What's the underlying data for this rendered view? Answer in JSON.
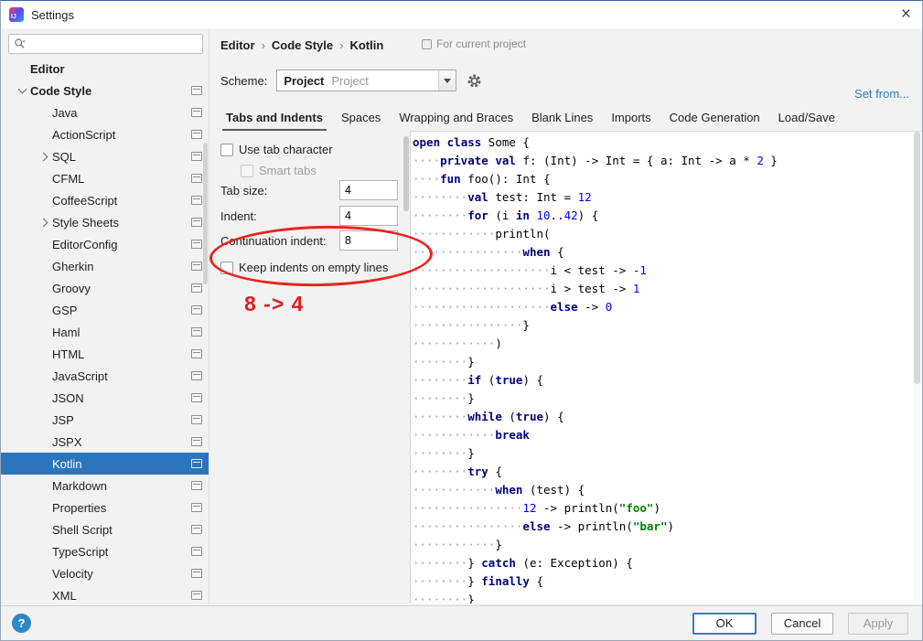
{
  "window": {
    "title": "Settings",
    "close_glyph": "×",
    "logo_text": "IJ"
  },
  "colors": {
    "selection_blue": "#2b75bd",
    "link_blue": "#2e7bc4",
    "annotation_red": "#e02020",
    "syntax_keyword": "#000080",
    "syntax_number": "#0000ff",
    "syntax_string": "#008000"
  },
  "sidebar": {
    "search": {
      "value": ""
    },
    "tree": [
      {
        "label": "Editor",
        "level": 0,
        "bold": true,
        "arrow": "none",
        "icon": false
      },
      {
        "label": "Code Style",
        "level": 0,
        "bold": true,
        "arrow": "down",
        "icon": true
      },
      {
        "label": "Java",
        "level": 1,
        "arrow": "none",
        "icon": true
      },
      {
        "label": "ActionScript",
        "level": 1,
        "arrow": "none",
        "icon": true
      },
      {
        "label": "SQL",
        "level": 1,
        "arrow": "right",
        "icon": true
      },
      {
        "label": "CFML",
        "level": 1,
        "arrow": "none",
        "icon": true
      },
      {
        "label": "CoffeeScript",
        "level": 1,
        "arrow": "none",
        "icon": true
      },
      {
        "label": "Style Sheets",
        "level": 1,
        "arrow": "right",
        "icon": true
      },
      {
        "label": "EditorConfig",
        "level": 1,
        "arrow": "none",
        "icon": true
      },
      {
        "label": "Gherkin",
        "level": 1,
        "arrow": "none",
        "icon": true
      },
      {
        "label": "Groovy",
        "level": 1,
        "arrow": "none",
        "icon": true
      },
      {
        "label": "GSP",
        "level": 1,
        "arrow": "none",
        "icon": true
      },
      {
        "label": "Haml",
        "level": 1,
        "arrow": "none",
        "icon": true
      },
      {
        "label": "HTML",
        "level": 1,
        "arrow": "none",
        "icon": true
      },
      {
        "label": "JavaScript",
        "level": 1,
        "arrow": "none",
        "icon": true
      },
      {
        "label": "JSON",
        "level": 1,
        "arrow": "none",
        "icon": true
      },
      {
        "label": "JSP",
        "level": 1,
        "arrow": "none",
        "icon": true
      },
      {
        "label": "JSPX",
        "level": 1,
        "arrow": "none",
        "icon": true
      },
      {
        "label": "Kotlin",
        "level": 1,
        "arrow": "none",
        "icon": true,
        "selected": true
      },
      {
        "label": "Markdown",
        "level": 1,
        "arrow": "none",
        "icon": true
      },
      {
        "label": "Properties",
        "level": 1,
        "arrow": "none",
        "icon": true
      },
      {
        "label": "Shell Script",
        "level": 1,
        "arrow": "none",
        "icon": true
      },
      {
        "label": "TypeScript",
        "level": 1,
        "arrow": "none",
        "icon": true
      },
      {
        "label": "Velocity",
        "level": 1,
        "arrow": "none",
        "icon": true
      },
      {
        "label": "XML",
        "level": 1,
        "arrow": "none",
        "icon": true
      }
    ]
  },
  "header": {
    "breadcrumb": [
      "Editor",
      "Code Style",
      "Kotlin"
    ],
    "separator": "›",
    "scope_note": "For current project",
    "scheme_label": "Scheme:",
    "scheme_value": "Project",
    "scheme_value_secondary": "Project",
    "set_from": "Set from..."
  },
  "tabs": [
    {
      "label": "Tabs and Indents",
      "selected": true
    },
    {
      "label": "Spaces",
      "selected": false
    },
    {
      "label": "Wrapping and Braces",
      "selected": false
    },
    {
      "label": "Blank Lines",
      "selected": false
    },
    {
      "label": "Imports",
      "selected": false
    },
    {
      "label": "Code Generation",
      "selected": false
    },
    {
      "label": "Load/Save",
      "selected": false
    }
  ],
  "form": {
    "use_tab_character": {
      "label": "Use tab character",
      "checked": false
    },
    "smart_tabs": {
      "label": "Smart tabs",
      "checked": false,
      "disabled": true
    },
    "tab_size": {
      "label": "Tab size:",
      "value": "4"
    },
    "indent": {
      "label": "Indent:",
      "value": "4"
    },
    "continuation_indent": {
      "label": "Continuation indent:",
      "value": "8"
    },
    "keep_indents": {
      "label": "Keep indents on empty lines",
      "checked": false
    },
    "annotation_text": "8 -> 4"
  },
  "preview": {
    "lines": [
      {
        "indent": 0,
        "tokens": [
          [
            "open ",
            "kw"
          ],
          [
            "class ",
            "kw"
          ],
          [
            "Some {",
            "pl"
          ]
        ]
      },
      {
        "indent": 4,
        "tokens": [
          [
            "private ",
            "kw"
          ],
          [
            "val ",
            "kw"
          ],
          [
            "f: (Int) -> Int = { a: Int -> a * ",
            "pl"
          ],
          [
            "2",
            "num"
          ],
          [
            " }",
            "pl"
          ]
        ]
      },
      {
        "indent": 4,
        "tokens": [
          [
            "fun ",
            "kw"
          ],
          [
            "foo(): Int {",
            "pl"
          ]
        ]
      },
      {
        "indent": 8,
        "tokens": [
          [
            "val ",
            "kw"
          ],
          [
            "test: Int = ",
            "pl"
          ],
          [
            "12",
            "num"
          ]
        ]
      },
      {
        "indent": 8,
        "tokens": [
          [
            "for ",
            "kw"
          ],
          [
            "(i ",
            "pl"
          ],
          [
            "in ",
            "kw"
          ],
          [
            "10",
            "num"
          ],
          [
            "..",
            "pl"
          ],
          [
            "42",
            "num"
          ],
          [
            ") {",
            "pl"
          ]
        ]
      },
      {
        "indent": 12,
        "tokens": [
          [
            "println(",
            "pl"
          ]
        ]
      },
      {
        "indent": 16,
        "tokens": [
          [
            "when ",
            "kw"
          ],
          [
            "{",
            "pl"
          ]
        ]
      },
      {
        "indent": 20,
        "tokens": [
          [
            "i < test -> ",
            "pl"
          ],
          [
            "-1",
            "num"
          ]
        ]
      },
      {
        "indent": 20,
        "tokens": [
          [
            "i > test -> ",
            "pl"
          ],
          [
            "1",
            "num"
          ]
        ]
      },
      {
        "indent": 20,
        "tokens": [
          [
            "else ",
            "kw"
          ],
          [
            "-> ",
            "pl"
          ],
          [
            "0",
            "num"
          ]
        ]
      },
      {
        "indent": 16,
        "tokens": [
          [
            "}",
            "pl"
          ]
        ]
      },
      {
        "indent": 12,
        "tokens": [
          [
            ")",
            "pl"
          ]
        ]
      },
      {
        "indent": 8,
        "tokens": [
          [
            "}",
            "pl"
          ]
        ]
      },
      {
        "indent": 8,
        "tokens": [
          [
            "if ",
            "kw"
          ],
          [
            "(",
            "pl"
          ],
          [
            "true",
            "kw"
          ],
          [
            ") {",
            "pl"
          ]
        ]
      },
      {
        "indent": 8,
        "tokens": [
          [
            "}",
            "pl"
          ]
        ]
      },
      {
        "indent": 8,
        "tokens": [
          [
            "while ",
            "kw"
          ],
          [
            "(",
            "pl"
          ],
          [
            "true",
            "kw"
          ],
          [
            ") {",
            "pl"
          ]
        ]
      },
      {
        "indent": 12,
        "tokens": [
          [
            "break",
            "kw"
          ]
        ]
      },
      {
        "indent": 8,
        "tokens": [
          [
            "}",
            "pl"
          ]
        ]
      },
      {
        "indent": 8,
        "tokens": [
          [
            "try ",
            "kw"
          ],
          [
            "{",
            "pl"
          ]
        ]
      },
      {
        "indent": 12,
        "tokens": [
          [
            "when ",
            "kw"
          ],
          [
            "(test) {",
            "pl"
          ]
        ]
      },
      {
        "indent": 16,
        "tokens": [
          [
            "12",
            "num"
          ],
          [
            " -> println(",
            "pl"
          ],
          [
            "\"foo\"",
            "str"
          ],
          [
            ")",
            "pl"
          ]
        ]
      },
      {
        "indent": 16,
        "tokens": [
          [
            "else ",
            "kw"
          ],
          [
            "-> println(",
            "pl"
          ],
          [
            "\"bar\"",
            "str"
          ],
          [
            ")",
            "pl"
          ]
        ]
      },
      {
        "indent": 12,
        "tokens": [
          [
            "}",
            "pl"
          ]
        ]
      },
      {
        "indent": 8,
        "tokens": [
          [
            "} ",
            "pl"
          ],
          [
            "catch ",
            "kw"
          ],
          [
            "(e: Exception) {",
            "pl"
          ]
        ]
      },
      {
        "indent": 8,
        "tokens": [
          [
            "} ",
            "pl"
          ],
          [
            "finally ",
            "kw"
          ],
          [
            "{",
            "pl"
          ]
        ]
      },
      {
        "indent": 8,
        "tokens": [
          [
            "}",
            "pl"
          ]
        ]
      }
    ]
  },
  "footer": {
    "ok": "OK",
    "cancel": "Cancel",
    "apply": "Apply",
    "help": "?"
  }
}
